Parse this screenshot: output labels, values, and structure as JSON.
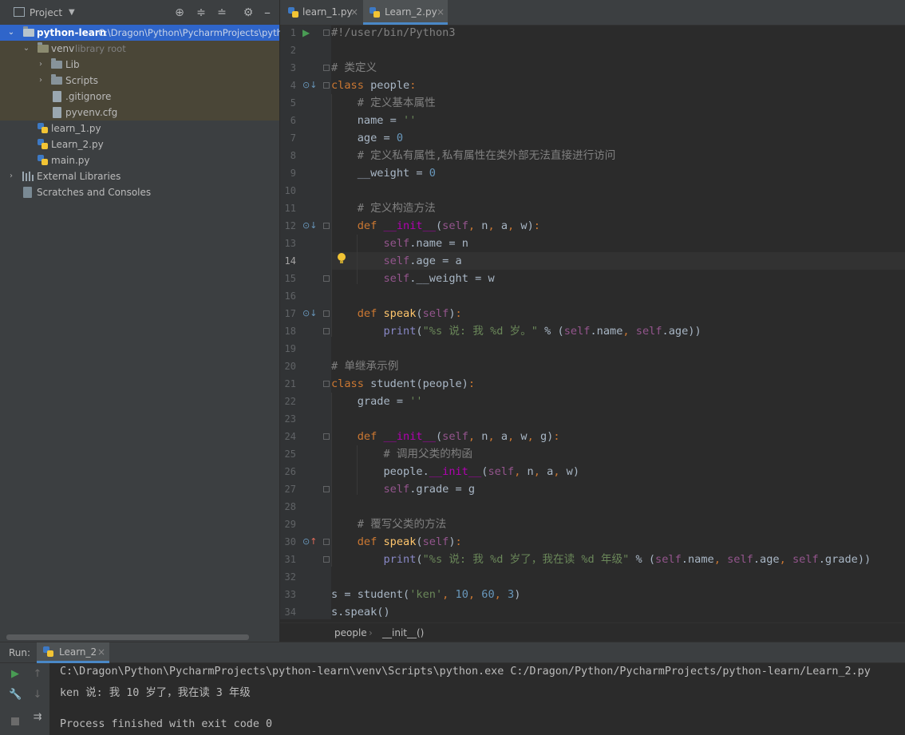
{
  "project": {
    "title": "Project",
    "root_name": "python-learn",
    "root_path": "C:\\Dragon\\Python\\PycharmProjects\\pytho",
    "venv": "venv",
    "venv_note": "library root",
    "lib": "Lib",
    "scripts": "Scripts",
    "gitignore": ".gitignore",
    "pyvenv": "pyvenv.cfg",
    "files": [
      "learn_1.py",
      "Learn_2.py",
      "main.py"
    ],
    "external": "External Libraries",
    "scratches": "Scratches and Consoles"
  },
  "tabs": [
    {
      "label": "learn_1.py",
      "close": "×"
    },
    {
      "label": "Learn_2.py",
      "close": "×"
    }
  ],
  "editor": {
    "line_numbers": [
      "1",
      "2",
      "3",
      "4",
      "5",
      "6",
      "7",
      "8",
      "9",
      "10",
      "11",
      "12",
      "13",
      "14",
      "15",
      "16",
      "17",
      "18",
      "19",
      "20",
      "21",
      "22",
      "23",
      "24",
      "25",
      "26",
      "27",
      "28",
      "29",
      "30",
      "31",
      "32",
      "33",
      "34"
    ],
    "lines": [
      "#!/user/bin/Python3",
      "",
      "# 类定义",
      "class people:",
      "    # 定义基本属性",
      "    name = ''",
      "    age = 0",
      "    # 定义私有属性,私有属性在类外部无法直接进行访问",
      "    __weight = 0",
      "",
      "    # 定义构造方法",
      "    def __init__(self, n, a, w):",
      "        self.name = n",
      "        self.age = a",
      "        self.__weight = w",
      "",
      "    def speak(self):",
      "        print(\"%s 说: 我 %d 岁。\" % (self.name, self.age))",
      "",
      "# 单继承示例",
      "class student(people):",
      "    grade = ''",
      "",
      "    def __init__(self, n, a, w, g):",
      "        # 调用父类的构函",
      "        people.__init__(self, n, a, w)",
      "        self.grade = g",
      "",
      "    # 覆写父类的方法",
      "    def speak(self):",
      "        print(\"%s 说: 我 %d 岁了，我在读 %d 年级\" % (self.name, self.age, self.grade))",
      "",
      "s = student('ken', 10, 60, 3)",
      "s.speak()"
    ],
    "current_line": "14"
  },
  "breadcrumb": [
    "people",
    "__init__()"
  ],
  "breadcrumb_sep": "›",
  "run": {
    "label": "Run:",
    "config": "Learn_2",
    "close": "×",
    "output": [
      "C:\\Dragon\\Python\\PycharmProjects\\python-learn\\venv\\Scripts\\python.exe C:/Dragon/Python/PycharmProjects/python-learn/Learn_2.py",
      "ken 说: 我 10 岁了，我在读 3 年级",
      "",
      "Process finished with exit code 0"
    ]
  },
  "colors": {
    "selection": "#2f65ca",
    "excluded_bg": "#4a4637",
    "keyword": "#cc7832",
    "string": "#6a8759",
    "number": "#6897bb",
    "comment": "#808080",
    "self": "#94558d",
    "function": "#ffc66d"
  }
}
